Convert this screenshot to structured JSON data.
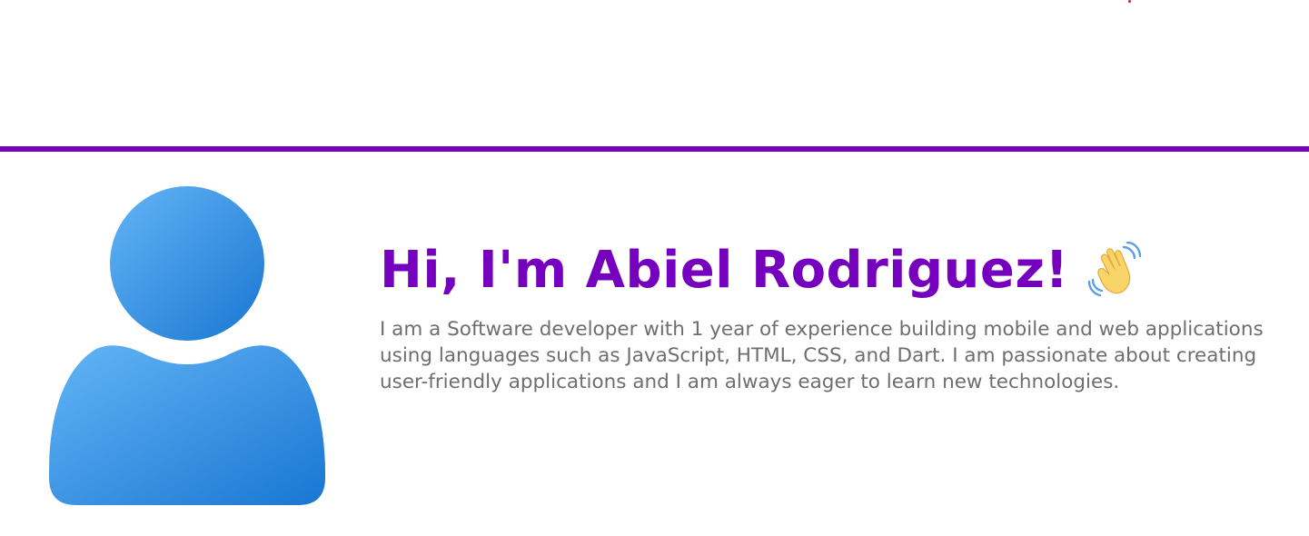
{
  "hero": {
    "title": "Hi, I'm Abiel Rodriguez!",
    "wave_emoji_icon": "waving-hand-icon",
    "description": "I am a Software developer with 1 year of experience building mobile and web applications using languages such as JavaScript, HTML, CSS, and Dart. I am passionate about creating user-friendly applications and I am always eager to learn new technologies.",
    "avatar_icon": "user-avatar-icon"
  },
  "colors": {
    "accent": "#7500bd",
    "text": "#6e6e6e",
    "avatar_light": "#64b5f6",
    "avatar_dark": "#1976d2"
  }
}
